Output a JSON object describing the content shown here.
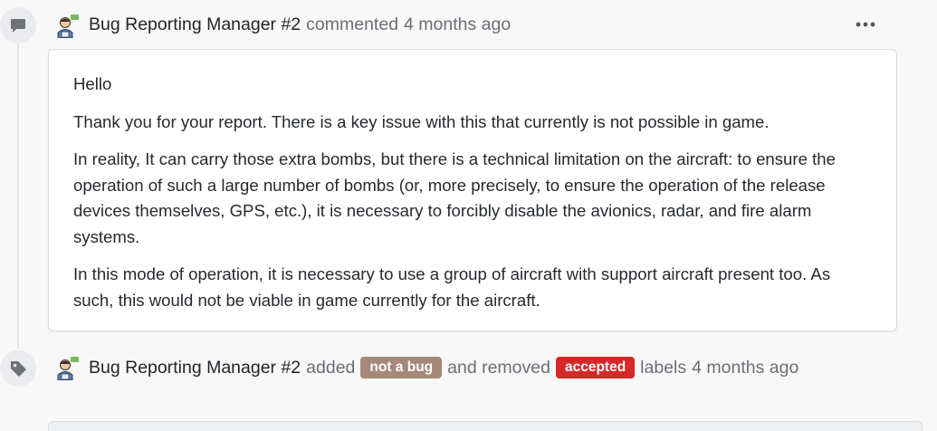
{
  "comment": {
    "author": "Bug Reporting Manager #2",
    "action": "commented",
    "time": "4 months ago",
    "menu_icon": "more-horizontal-icon",
    "paragraphs": [
      "Hello",
      "Thank you for your report. There is a key issue with this that currently is not possible in game.",
      "In reality, It can carry those extra bombs, but there is a technical limitation on the aircraft: to ensure the operation of such a large number of bombs (or, more precisely, to ensure the operation of the release devices themselves, GPS, etc.), it is necessary to forcibly disable the avionics, radar, and fire alarm systems.",
      "In this mode of operation, it is necessary to use a group of aircraft with support aircraft present too. As such, this would not be viable in game currently for the aircraft."
    ]
  },
  "label_event": {
    "author": "Bug Reporting Manager #2",
    "added_text": "added",
    "added_label": {
      "text": "not a bug",
      "color": "#a5887a"
    },
    "removed_text": "and removed",
    "removed_label": {
      "text": "accepted",
      "color": "#d62828"
    },
    "labels_text": "labels",
    "time": "4 months ago"
  },
  "icons": {
    "comment_badge": "comment-icon",
    "label_badge": "tag-icon",
    "avatar": "manager-avatar-icon"
  }
}
